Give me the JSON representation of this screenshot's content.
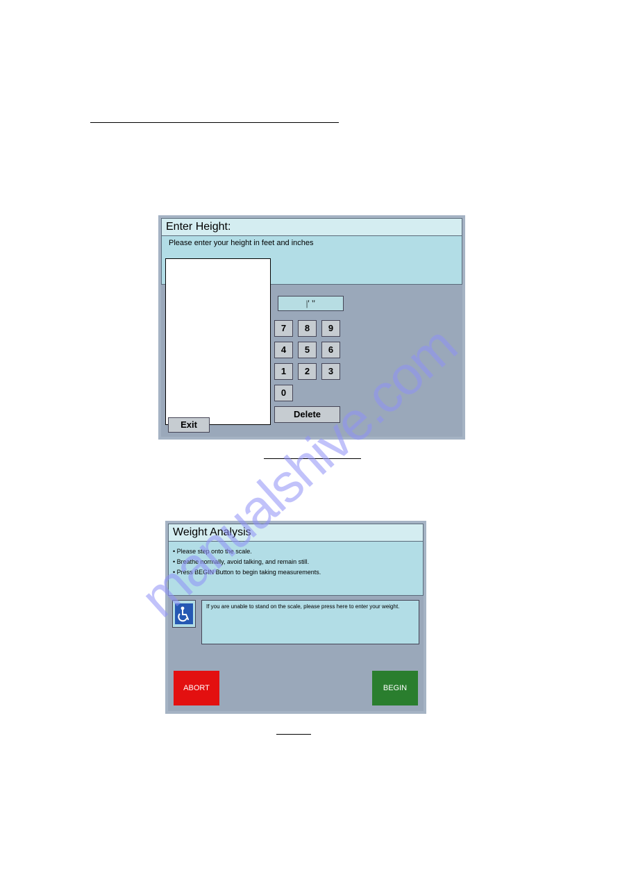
{
  "watermark": "manualshive.com",
  "height_panel": {
    "title": "Enter Height:",
    "instruction": "Please enter your height in feet and inches",
    "display_value": "|' \"",
    "keys": {
      "k7": "7",
      "k8": "8",
      "k9": "9",
      "k4": "4",
      "k5": "5",
      "k6": "6",
      "k1": "1",
      "k2": "2",
      "k3": "3",
      "k0": "0"
    },
    "delete_label": "Delete",
    "exit_label": "Exit"
  },
  "weight_panel": {
    "title": "Weight Analysis",
    "step1": "• Please step onto the scale.",
    "step2": "• Breathe normally, avoid talking, and remain still.",
    "step3": "• Press BEGIN Button to begin taking measurements.",
    "accessibility_text": "If you are unable to stand on the scale, please press here to enter your weight.",
    "wheelchair_icon_name": "wheelchair-icon",
    "abort_label": "ABORT",
    "begin_label": "BEGIN"
  }
}
